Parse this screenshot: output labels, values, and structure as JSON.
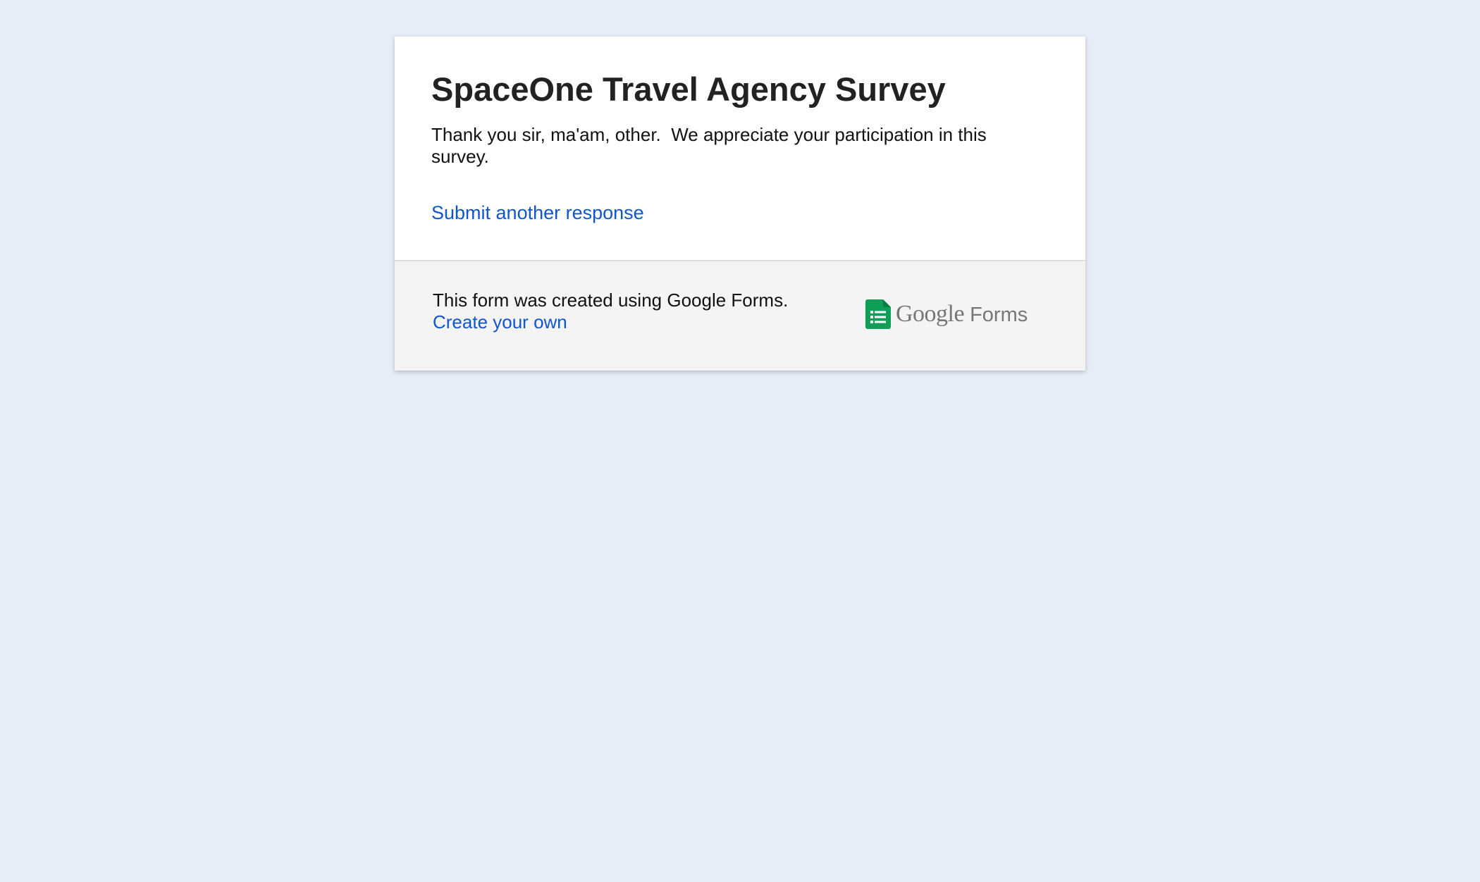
{
  "colors": {
    "page_background": "#e6edf7",
    "card_background": "#ffffff",
    "footer_background": "#f4f4f4",
    "divider": "#dcdcdc",
    "title_text": "#222222",
    "body_text": "#111111",
    "link": "#1155cc",
    "brand_green": "#0f9d58",
    "brand_gray": "#777777"
  },
  "form": {
    "title": "SpaceOne Travel Agency Survey",
    "confirmation_message": "Thank you sir, ma'am, other.  We appreciate your participation in this survey.",
    "submit_another_label": "Submit another response"
  },
  "footer": {
    "created_text": "This form was created using Google Forms.",
    "create_own_label": "Create your own",
    "brand": {
      "icon": "google-forms-icon",
      "word_google": "Google",
      "word_forms": "Forms"
    }
  }
}
